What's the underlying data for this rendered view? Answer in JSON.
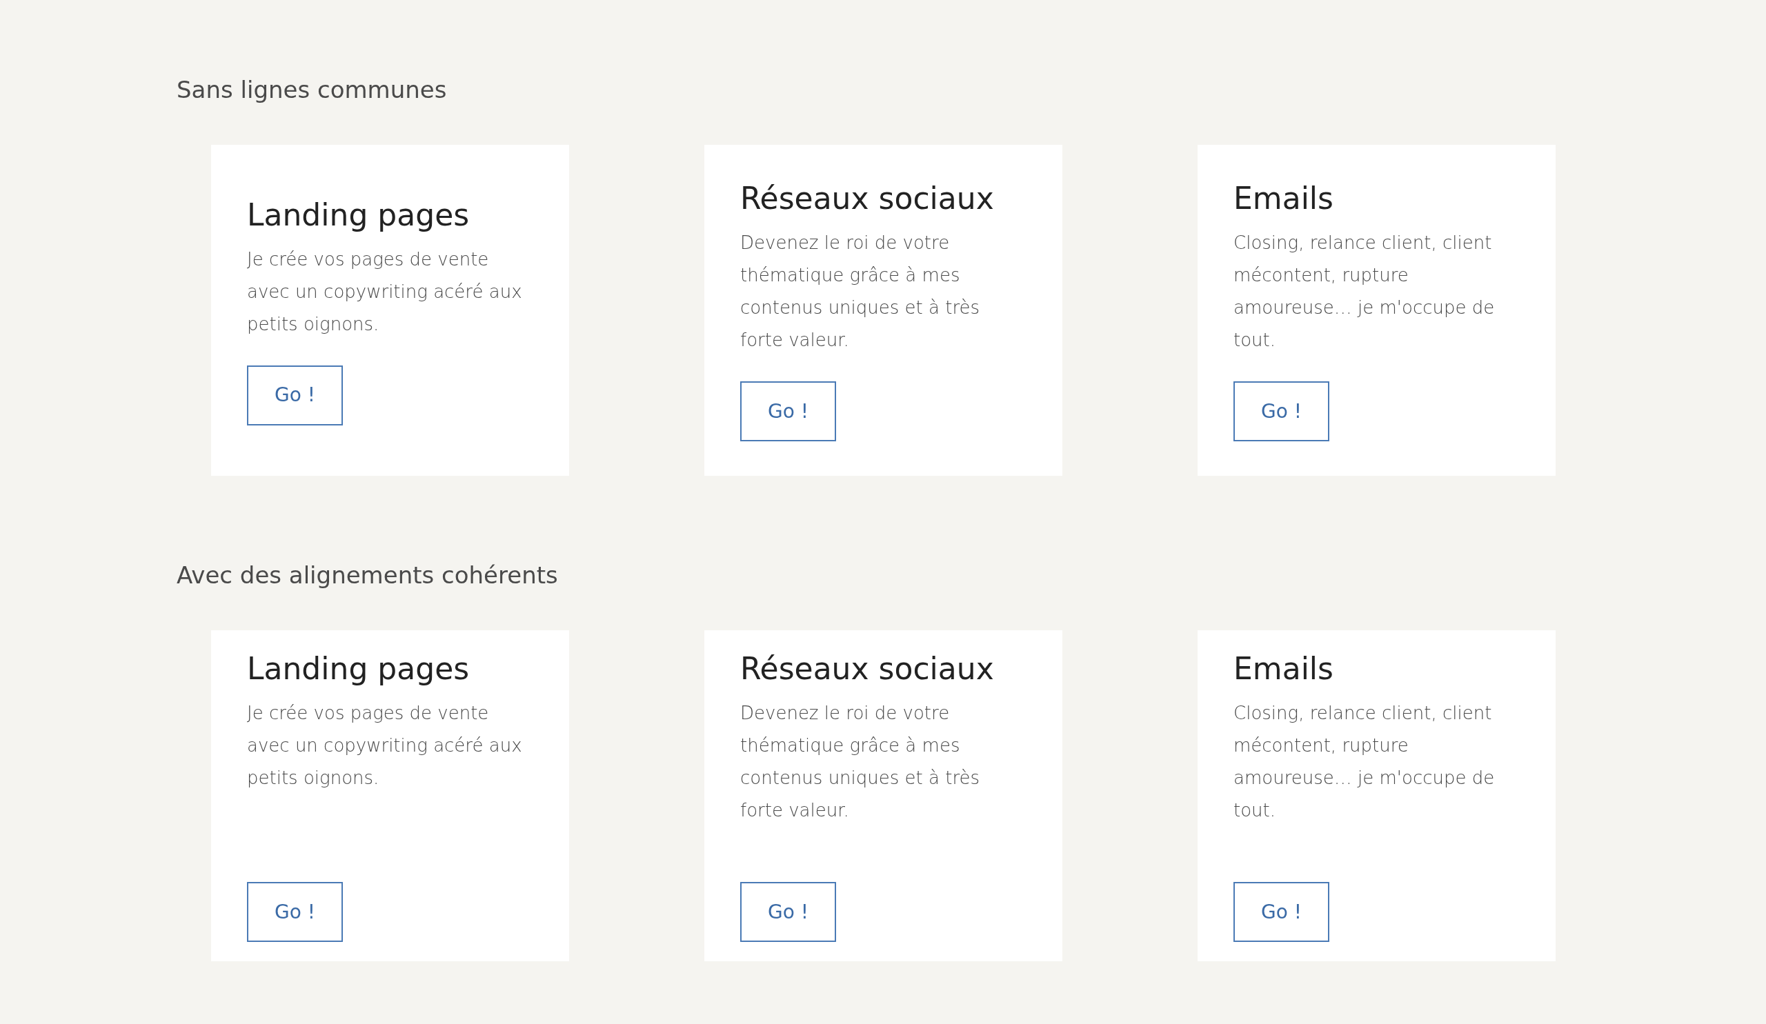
{
  "sections": [
    {
      "heading": "Sans lignes communes",
      "kind": "centered",
      "cards": [
        {
          "title": "Landing pages",
          "text": "Je crée vos pages de vente avec un copywriting acéré aux petits oignons.",
          "button": "Go !"
        },
        {
          "title": "Réseaux sociaux",
          "text": "Devenez le roi de votre thématique grâce à mes contenus uniques et à très forte valeur.",
          "button": "Go !"
        },
        {
          "title": "Emails",
          "text": "Closing, relance client, client mécontent, rupture amoureuse… je m'occupe de tout.",
          "button": "Go !"
        }
      ]
    },
    {
      "heading": "Avec des alignements cohérents",
      "kind": "aligned",
      "cards": [
        {
          "title": "Landing pages",
          "text": "Je crée vos pages de vente avec un copywriting acéré aux petits oignons.",
          "button": "Go !"
        },
        {
          "title": "Réseaux sociaux",
          "text": "Devenez le roi de votre thématique grâce à mes contenus uniques et à très forte valeur.",
          "button": "Go !"
        },
        {
          "title": "Emails",
          "text": "Closing, relance client, client mécontent, rupture amoureuse… je m'occupe de tout.",
          "button": "Go !"
        }
      ]
    }
  ]
}
